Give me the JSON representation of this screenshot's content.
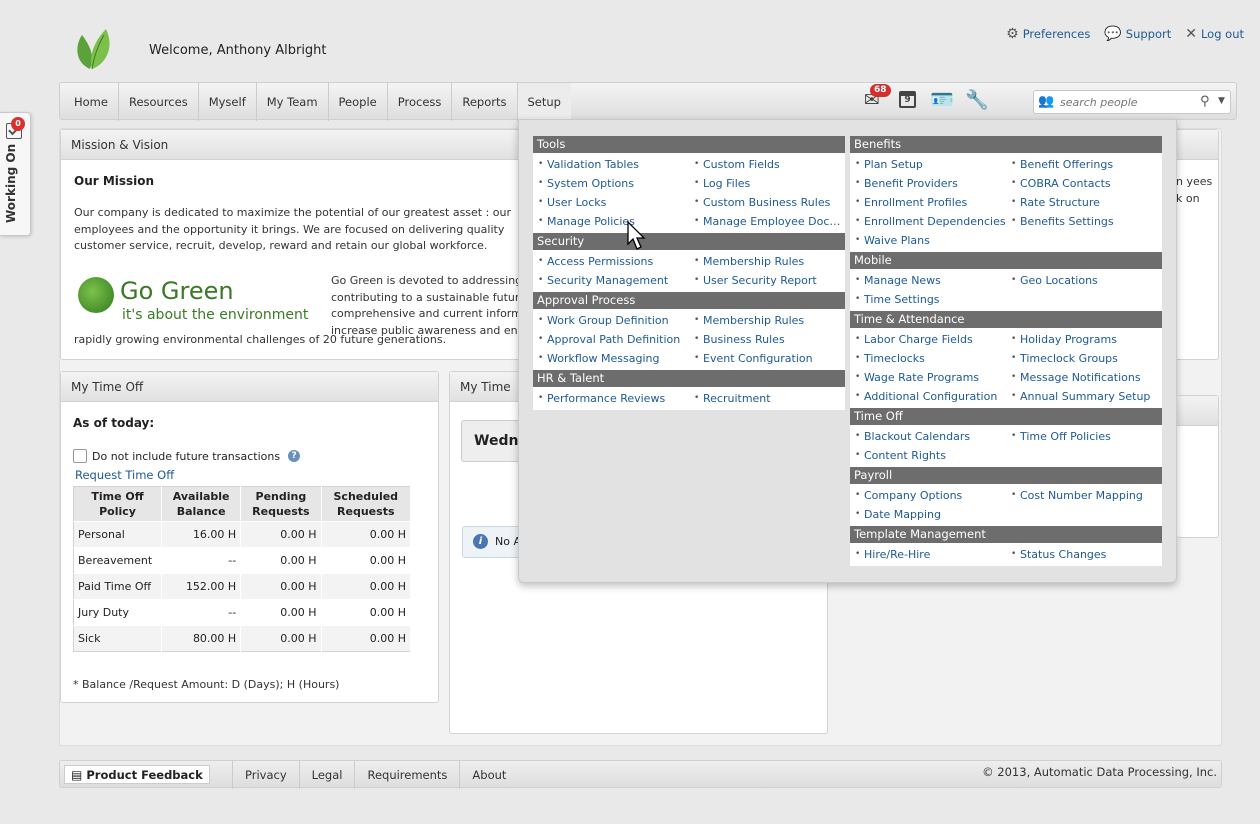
{
  "header": {
    "welcome": "Welcome, Anthony Albright",
    "links": [
      {
        "icon": "gear-icon",
        "label": "Preferences"
      },
      {
        "icon": "speech-bubble-icon",
        "label": "Support"
      },
      {
        "icon": "x-icon",
        "label": "Log out"
      }
    ]
  },
  "side_tab": {
    "label": "Working On",
    "badge": "0"
  },
  "nav": {
    "items": [
      "Home",
      "Resources",
      "Myself",
      "My Team",
      "People",
      "Process",
      "Reports",
      "Setup"
    ],
    "mail_badge": "68",
    "calendar_day": "9",
    "search_placeholder": "search people"
  },
  "mission": {
    "panel_title": "Mission & Vision",
    "heading": "Our Mission",
    "text": "Our company is dedicated to maximize the potential of our greatest asset : our employees and the opportunity it brings. We are focused on delivering quality customer service, recruit, develop, reward and retain our global workforce.",
    "green_title": "Go Green",
    "green_sub": "it's about the environment",
    "green_text": "Go Green is devoted to addressing contributing to a sustainable future comprehensive and current inform increase public awareness and enc",
    "green_text_last": "rapidly growing environmental challenges of 20 future generations.",
    "right_text": "n yees k on"
  },
  "timeoff": {
    "panel_title": "My Time Off",
    "as_of": "As of today:",
    "checkbox_label": "Do not include future transactions",
    "request_link": "Request Time Off",
    "columns": [
      "Time Off Policy",
      "Available Balance",
      "Pending Requests",
      "Scheduled Requests"
    ],
    "rows": [
      [
        "Personal",
        "16.00 H",
        "0.00 H",
        "0.00 H"
      ],
      [
        "Bereavement",
        "--",
        "0.00 H",
        "0.00 H"
      ],
      [
        "Paid Time Off",
        "152.00 H",
        "0.00 H",
        "0.00 H"
      ],
      [
        "Jury Duty",
        "--",
        "0.00 H",
        "0.00 H"
      ],
      [
        "Sick",
        "80.00 H",
        "0.00 H",
        "0.00 H"
      ]
    ],
    "footnote": "* Balance /Request Amount: D (Days); H (Hours)"
  },
  "mytime": {
    "panel_title": "My Time",
    "day": "Wedne",
    "notice": "No A"
  },
  "footer": {
    "feedback": "Product Feedback",
    "links": [
      "Privacy",
      "Legal",
      "Requirements",
      "About"
    ],
    "copyright": "© 2013, Automatic Data Processing, Inc."
  },
  "setup_menu": {
    "left": [
      {
        "title": "Tools",
        "items": [
          "Validation Tables",
          "Custom Fields",
          "System Options",
          "Log Files",
          "User Locks",
          "Custom Business Rules",
          "Manage Policies",
          "Manage Employee Docu..."
        ]
      },
      {
        "title": "Security",
        "items": [
          "Access Permissions",
          "Membership Rules",
          "Security Management",
          "User Security Report"
        ]
      },
      {
        "title": "Approval Process",
        "items": [
          "Work Group Definition",
          "Membership Rules",
          "Approval Path Definition",
          "Business Rules",
          "Workflow Messaging",
          "Event Configuration"
        ]
      },
      {
        "title": "HR & Talent",
        "items": [
          "Performance Reviews",
          "Recruitment"
        ]
      }
    ],
    "right": [
      {
        "title": "Benefits",
        "items": [
          "Plan Setup",
          "Benefit Offerings",
          "Benefit Providers",
          "COBRA Contacts",
          "Enrollment Profiles",
          "Rate Structure",
          "Enrollment Dependencies",
          "Benefits Settings",
          "Waive Plans"
        ]
      },
      {
        "title": "Mobile",
        "items": [
          "Manage News",
          "Geo Locations",
          "Time Settings"
        ]
      },
      {
        "title": "Time & Attendance",
        "items": [
          "Labor Charge Fields",
          "Holiday Programs",
          "Timeclocks",
          "Timeclock Groups",
          "Wage Rate Programs",
          "Message Notifications",
          "Additional Configuration",
          "Annual Summary Setup"
        ]
      },
      {
        "title": "Time Off",
        "items": [
          "Blackout Calendars",
          "Time Off Policies",
          "Content Rights"
        ]
      },
      {
        "title": "Payroll",
        "items": [
          "Company Options",
          "Cost Number Mapping",
          "Date Mapping"
        ]
      },
      {
        "title": "Template Management",
        "items": [
          "Hire/Re-Hire",
          "Status Changes"
        ]
      }
    ]
  }
}
